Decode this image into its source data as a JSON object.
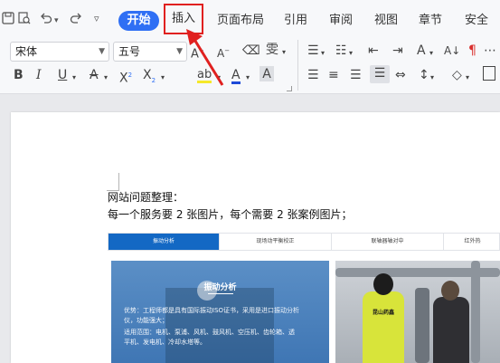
{
  "tabs": {
    "start": "开始",
    "insert": "插入",
    "layout": "页面布局",
    "reference": "引用",
    "review": "审阅",
    "view": "视图",
    "section": "章节",
    "security": "安全"
  },
  "font": {
    "family": "宋体",
    "size": "五号"
  },
  "doc": {
    "line1": "网站问题整理：",
    "line2": "每一个服务要 2 张图片，每个需要 2 张案例图片；"
  },
  "image": {
    "tabs": [
      "振动分析",
      "现场动平衡校正",
      "联轴器轴对中",
      "红外热"
    ],
    "card_title": "振动分析",
    "card_lines": [
      "优势：工程师都是具有国际振动ISO证书，采用是进口振动分析",
      "仪，功能强大；",
      "适用范围：电机、泵浦、风机、鼓风机、空压机、齿轮箱、透",
      "平机、发电机、冷却水塔等。"
    ],
    "vest_text": "昆山药鑫"
  },
  "colors": {
    "accent": "#2f6ff4",
    "highlight_box": "#e0201f",
    "site_blue": "#1368c4"
  }
}
